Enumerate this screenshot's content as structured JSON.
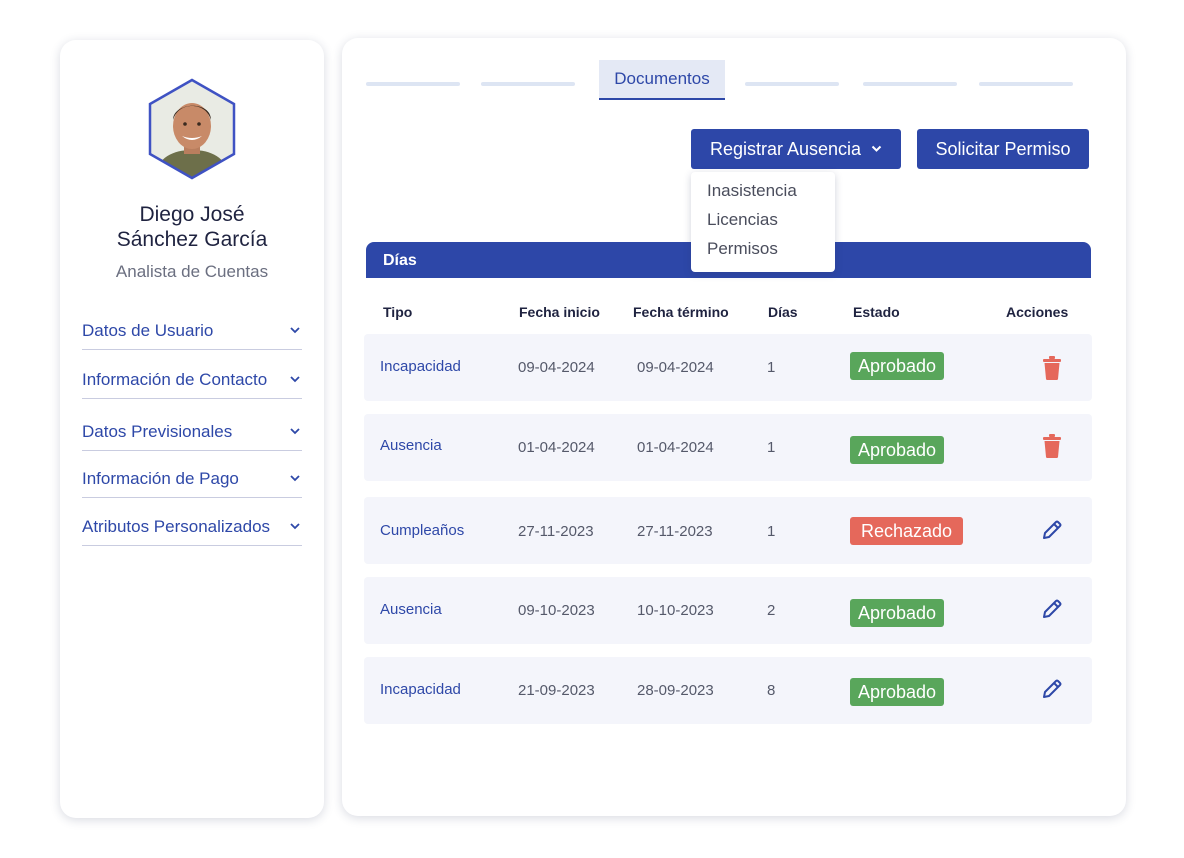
{
  "profile": {
    "name_line1": "Diego José",
    "name_line2": "Sánchez García",
    "role": "Analista de Cuentas"
  },
  "sidebar": {
    "items": [
      {
        "label": "Datos de Usuario"
      },
      {
        "label": "Información de Contacto"
      },
      {
        "label": "Datos Previsionales"
      },
      {
        "label": "Información de Pago"
      },
      {
        "label": "Atributos Personalizados"
      }
    ]
  },
  "tabs": {
    "active_label": "Documentos"
  },
  "actions": {
    "register_label": "Registrar Ausencia",
    "request_label": "Solicitar Permiso",
    "dropdown": [
      "Inasistencia",
      "Licencias",
      "Permisos"
    ]
  },
  "table": {
    "section_title": "Días",
    "headers": [
      "Tipo",
      "Fecha inicio",
      "Fecha término",
      "Días",
      "Estado",
      "Acciones"
    ],
    "rows": [
      {
        "tipo": "Incapacidad",
        "inicio": "09-04-2024",
        "termino": "09-04-2024",
        "dias": "1",
        "estado": "Aprobado",
        "action": "trash-icon"
      },
      {
        "tipo": "Ausencia",
        "inicio": "01-04-2024",
        "termino": "01-04-2024",
        "dias": "1",
        "estado": "Aprobado",
        "action": "trash-icon"
      },
      {
        "tipo": "Cumpleaños",
        "inicio": "27-11-2023",
        "termino": "27-11-2023",
        "dias": "1",
        "estado": "Rechazado",
        "action": "pencil-icon"
      },
      {
        "tipo": "Ausencia",
        "inicio": "09-10-2023",
        "termino": "10-10-2023",
        "dias": "2",
        "estado": "Aprobado",
        "action": "pencil-icon"
      },
      {
        "tipo": "Incapacidad",
        "inicio": "21-09-2023",
        "termino": "28-09-2023",
        "dias": "8",
        "estado": "Aprobado",
        "action": "pencil-icon"
      }
    ]
  },
  "colors": {
    "primary": "#2d47a8",
    "approved": "#59a65b",
    "rejected": "#e5685b",
    "trash": "#e5685b"
  }
}
